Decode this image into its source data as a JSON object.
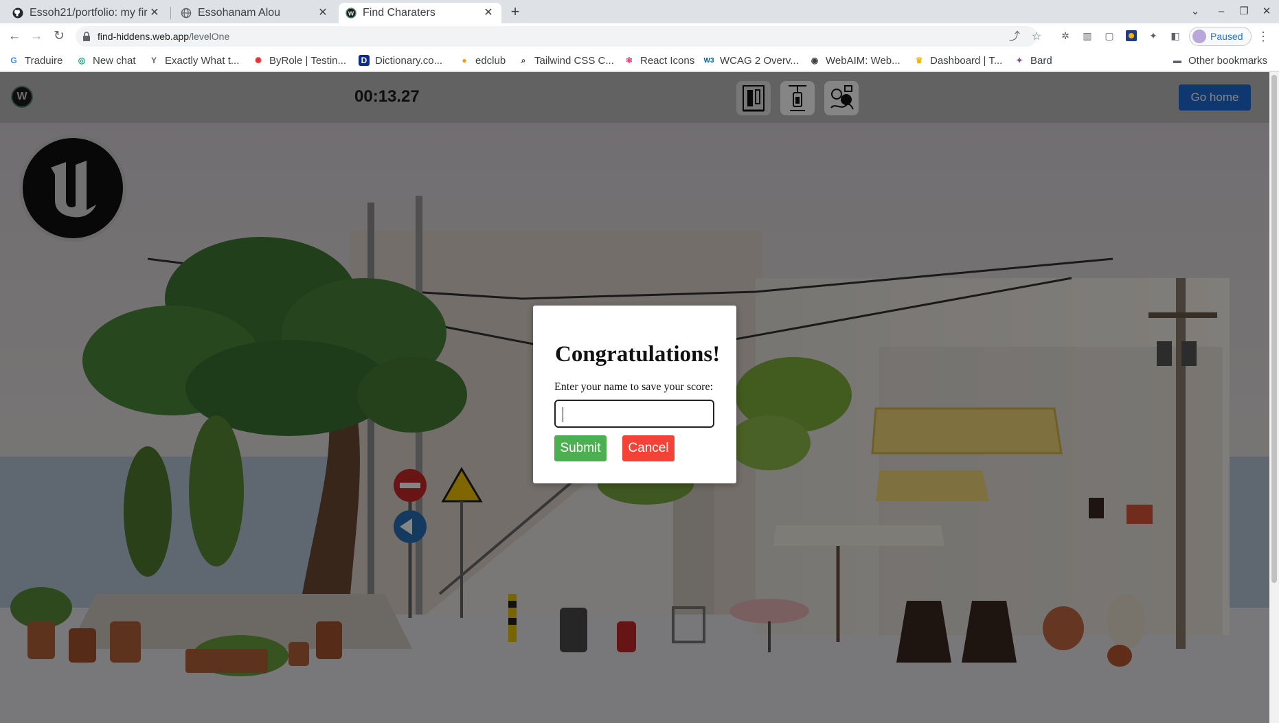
{
  "browser": {
    "tabs": [
      {
        "title": "Essoh21/portfolio: my fir",
        "icon": "github-icon",
        "active": false
      },
      {
        "title": "Essohanam Alou",
        "icon": "globe-icon",
        "active": false
      },
      {
        "title": "Find Charaters",
        "icon": "site-favicon",
        "active": true
      }
    ],
    "url_host": "find-hiddens.web.app",
    "url_path": "/levelOne",
    "profile_label": "Paused",
    "bookmarks": [
      {
        "label": "Traduire",
        "icon": "translate-icon",
        "color": "#4285f4"
      },
      {
        "label": "New chat",
        "icon": "chat-icon",
        "color": "#10a37f"
      },
      {
        "label": "Exactly What t...",
        "icon": "y-icon",
        "color": "#5f6368"
      },
      {
        "label": "ByRole | Testin...",
        "icon": "octopus-icon",
        "color": "#e33332"
      },
      {
        "label": "Dictionary.co...",
        "icon": "dictionary-icon",
        "color": "#0c2c8c"
      },
      {
        "label": "edclub",
        "icon": "edclub-icon",
        "color": "#f39c12"
      },
      {
        "label": "Tailwind CSS C...",
        "icon": "search-doc-icon",
        "color": "#3c4043"
      },
      {
        "label": "React Icons",
        "icon": "react-icon",
        "color": "#e91e63"
      },
      {
        "label": "WCAG 2 Overv...",
        "icon": "w3c-icon",
        "color": "#005a9c"
      },
      {
        "label": "WebAIM: Web...",
        "icon": "webaim-icon",
        "color": "#3c4043"
      },
      {
        "label": "Dashboard | T...",
        "icon": "dashboard-icon",
        "color": "#f4b400"
      },
      {
        "label": "Bard",
        "icon": "bard-icon",
        "color": "#8e44ad"
      }
    ],
    "other_bookmarks": "Other bookmarks"
  },
  "app": {
    "timer": "00:13.27",
    "go_home_label": "Go home",
    "characters": [
      {
        "name": "character-1",
        "found": true
      },
      {
        "name": "character-2",
        "found": false
      },
      {
        "name": "character-3",
        "found": false
      }
    ]
  },
  "modal": {
    "title": "Congratulations!",
    "prompt": "Enter your name to save your score:",
    "input_value": "",
    "input_placeholder": "",
    "submit_label": "Submit",
    "cancel_label": "Cancel"
  },
  "colors": {
    "submit": "#4caf50",
    "cancel": "#f44336",
    "go_home": "#1e6cd9"
  }
}
